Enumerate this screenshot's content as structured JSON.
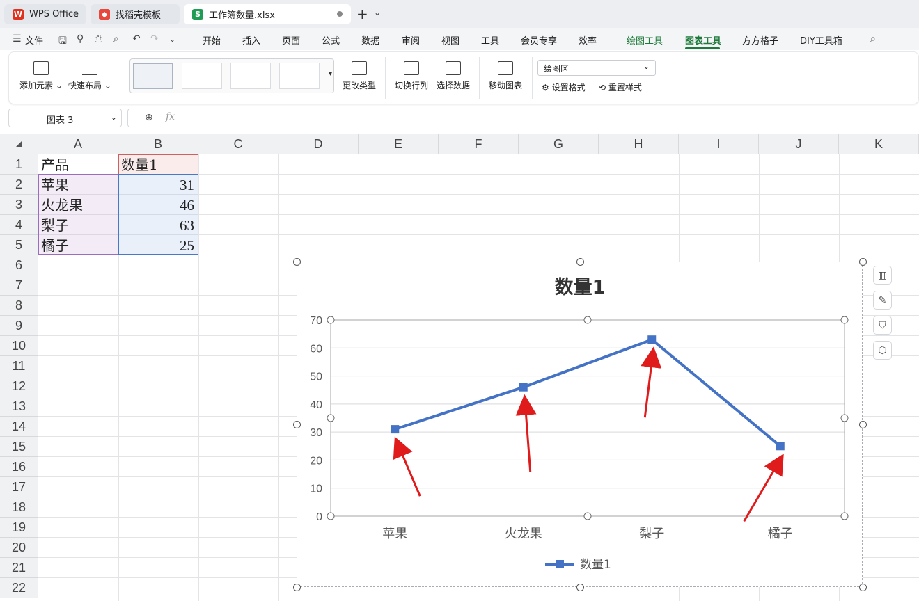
{
  "tabs": [
    {
      "label": "WPS Office",
      "icon": "wps-logo-icon"
    },
    {
      "label": "找稻壳模板",
      "icon": "daoke-icon"
    },
    {
      "label": "工作簿数量.xlsx",
      "icon": "spreadsheet-icon"
    }
  ],
  "menu": {
    "file": "文件",
    "items": [
      "开始",
      "插入",
      "页面",
      "公式",
      "数据",
      "审阅",
      "视图",
      "工具",
      "会员专享",
      "效率",
      "绘图工具",
      "图表工具",
      "方方格子",
      "DIY工具箱"
    ],
    "active": "图表工具"
  },
  "ribbon": {
    "add_element": "添加元素",
    "quick_layout": "快速布局",
    "change_type": "更改类型",
    "switch_row_col": "切换行列",
    "select_data": "选择数据",
    "move_chart": "移动图表",
    "area_select": "绘图区",
    "set_format": "设置格式",
    "reset_style": "重置样式"
  },
  "formula_bar": {
    "name_box": "图表 3",
    "fx": "fx",
    "content": ""
  },
  "columns": [
    "A",
    "B",
    "C",
    "D",
    "E",
    "F",
    "G",
    "H",
    "I",
    "J",
    "K"
  ],
  "rows": [
    "1",
    "2",
    "3",
    "4",
    "5",
    "6",
    "7",
    "8",
    "9",
    "10",
    "11",
    "12",
    "13",
    "14",
    "15",
    "16",
    "17",
    "18",
    "19",
    "20",
    "21",
    "22"
  ],
  "cells": {
    "A1": "产品",
    "B1": "数量1",
    "A2": "苹果",
    "B2": "31",
    "A3": "火龙果",
    "B3": "46",
    "A4": "梨子",
    "B4": "63",
    "A5": "橘子",
    "B5": "25"
  },
  "colors": {
    "series": "#4472c4",
    "arrow": "#e01b1b",
    "accent": "#1e7a3a"
  },
  "chart_data": {
    "type": "line",
    "title": "数量1",
    "categories": [
      "苹果",
      "火龙果",
      "梨子",
      "橘子"
    ],
    "series": [
      {
        "name": "数量1",
        "values": [
          31,
          46,
          63,
          25
        ]
      }
    ],
    "ylim": [
      0,
      70
    ],
    "yticks": [
      0,
      10,
      20,
      30,
      40,
      50,
      60,
      70
    ],
    "grid": true,
    "legend": "bottom"
  }
}
